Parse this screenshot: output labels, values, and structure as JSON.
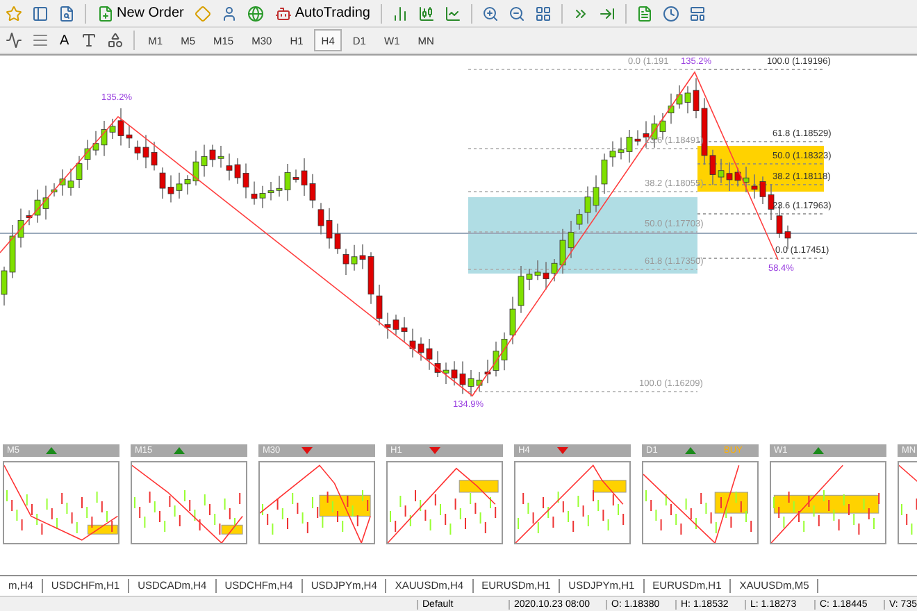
{
  "toolbar": {
    "new_order": "New Order",
    "auto_trading": "AutoTrading",
    "text_tool": "A",
    "timeframes": [
      {
        "label": "M1",
        "selected": false
      },
      {
        "label": "M5",
        "selected": false
      },
      {
        "label": "M15",
        "selected": false
      },
      {
        "label": "M30",
        "selected": false
      },
      {
        "label": "H1",
        "selected": false
      },
      {
        "label": "H4",
        "selected": true
      },
      {
        "label": "D1",
        "selected": false
      },
      {
        "label": "W1",
        "selected": false
      },
      {
        "label": "MN",
        "selected": false
      }
    ]
  },
  "chart": {
    "fib_left": [
      "0.0 (1.191",
      "23.6 (1.18491)",
      "38.2 (1.18055)",
      "50.0 (1.17703)",
      "61.8 (1.17350)",
      "100.0 (1.16209)"
    ],
    "fib_right": [
      "100.0 (1.19196)",
      "61.8 (1.18529)",
      "50.0 (1.18323)",
      "38.2 (1.18118)",
      "23.6 (1.17963)",
      "0.0 (1.17451)"
    ],
    "percent_labels": [
      "135.2%",
      "134.9%",
      "135.2%",
      "58.4%"
    ]
  },
  "thumbnails": [
    {
      "label": "M5",
      "bullish": true
    },
    {
      "label": "M15",
      "bullish": true
    },
    {
      "label": "M30",
      "bullish": false
    },
    {
      "label": "H1",
      "bullish": false
    },
    {
      "label": "H4",
      "bullish": false
    },
    {
      "label": "D1",
      "bullish": true,
      "badge": "BUY"
    },
    {
      "label": "W1",
      "bullish": true
    },
    {
      "label": "MN"
    }
  ],
  "tabs": [
    "m,H4",
    "USDCHFm,H1",
    "USDCADm,H4",
    "USDCHFm,H4",
    "USDJPYm,H4",
    "XAUUSDm,H4",
    "EURUSDm,H1",
    "USDJPYm,H1",
    "EURUSDm,H1",
    "XAUUSDm,M5"
  ],
  "status_bar": {
    "profile": "Default",
    "time": "2020.10.23 08:00",
    "open": "O: 1.18380",
    "high": "H: 1.18532",
    "low": "L: 1.18273",
    "close": "C: 1.18445",
    "volume": "V: 735"
  }
}
